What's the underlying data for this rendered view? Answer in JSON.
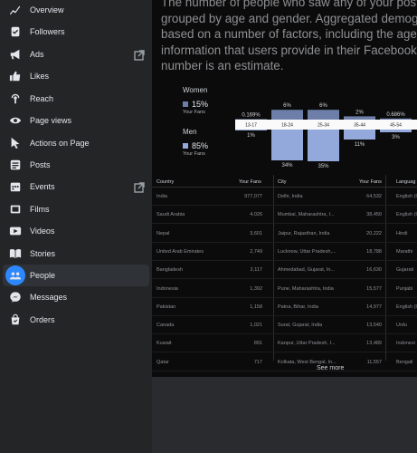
{
  "nav": {
    "items": [
      {
        "label": "Overview",
        "icon": "overview-icon"
      },
      {
        "label": "Followers",
        "icon": "followers-icon"
      },
      {
        "label": "Ads",
        "icon": "megaphone-icon"
      },
      {
        "label": "Likes",
        "icon": "thumbs-up-icon"
      },
      {
        "label": "Reach",
        "icon": "reach-icon"
      },
      {
        "label": "Page views",
        "icon": "eye-icon"
      },
      {
        "label": "Actions on Page",
        "icon": "cursor-icon"
      },
      {
        "label": "Posts",
        "icon": "posts-icon"
      },
      {
        "label": "Events",
        "icon": "calendar-icon"
      },
      {
        "label": "Films",
        "icon": "film-icon"
      },
      {
        "label": "Videos",
        "icon": "video-icon"
      },
      {
        "label": "Stories",
        "icon": "book-icon"
      },
      {
        "label": "People",
        "icon": "people-icon"
      },
      {
        "label": "Messages",
        "icon": "messenger-icon"
      },
      {
        "label": "Orders",
        "icon": "orders-icon"
      }
    ],
    "active": "People"
  },
  "description": {
    "line1": "The number of people who saw any of your posts",
    "line2": "grouped by age and gender. Aggregated demogra",
    "line3": "based on a number of factors, including the age a",
    "line4": "information that users provide in their Facebook p",
    "line5": "number is an estimate."
  },
  "colors": {
    "women": "#6d7ea8",
    "men": "#93a9db"
  },
  "legend": {
    "women": {
      "title": "Women",
      "pct": "15%",
      "sub": "Your Fans"
    },
    "men": {
      "title": "Men",
      "pct": "85%",
      "sub": "Your Fans"
    }
  },
  "chart_data": {
    "type": "bar",
    "categories": [
      "13-17",
      "18-24",
      "25-34",
      "35-44",
      "45-54"
    ],
    "series": [
      {
        "name": "Women",
        "values": [
          0.169,
          6,
          6,
          2,
          0.686
        ]
      },
      {
        "name": "Men",
        "values": [
          1,
          34,
          35,
          11,
          3
        ]
      }
    ],
    "women_labels": [
      "0.169%",
      "6%",
      "6%",
      "2%",
      "0.686%"
    ],
    "men_labels": [
      "1%",
      "34%",
      "35%",
      "11%",
      "3%"
    ]
  },
  "table": {
    "headers": {
      "country": "Country",
      "fans1": "Your Fans",
      "city": "City",
      "fans2": "Your Fans",
      "language": "Languag"
    },
    "rows": [
      [
        "India",
        "977,077",
        "Delhi, India",
        "64,532",
        "English (I"
      ],
      [
        "Saudi Arabia",
        "4,026",
        "Mumbai, Maharashtra, I...",
        "38,450",
        "English (I"
      ],
      [
        "Nepal",
        "3,601",
        "Jaipur, Rajasthan, India",
        "20,222",
        "Hindi"
      ],
      [
        "United Arab Emirates",
        "2,749",
        "Lucknow, Uttar Pradesh,...",
        "18,788",
        "Marathi"
      ],
      [
        "Bangladesh",
        "2,117",
        "Ahmedabad, Gujarat, In...",
        "16,630",
        "Gujarati"
      ],
      [
        "Indonesia",
        "1,392",
        "Pune, Maharashtra, India",
        "15,577",
        "Punjabi"
      ],
      [
        "Pakistan",
        "1,158",
        "Patna, Bihar, India",
        "14,977",
        "English (I"
      ],
      [
        "Canada",
        "1,021",
        "Surat, Gujarat, India",
        "13,540",
        "Urdu"
      ],
      [
        "Kuwait",
        "891",
        "Kanpur, Uttar Pradesh, I...",
        "13,489",
        "Indonesi"
      ],
      [
        "Qatar",
        "717",
        "Kolkata, West Bengal, In...",
        "11,557",
        "Bengali"
      ]
    ]
  },
  "see_more": "See more"
}
